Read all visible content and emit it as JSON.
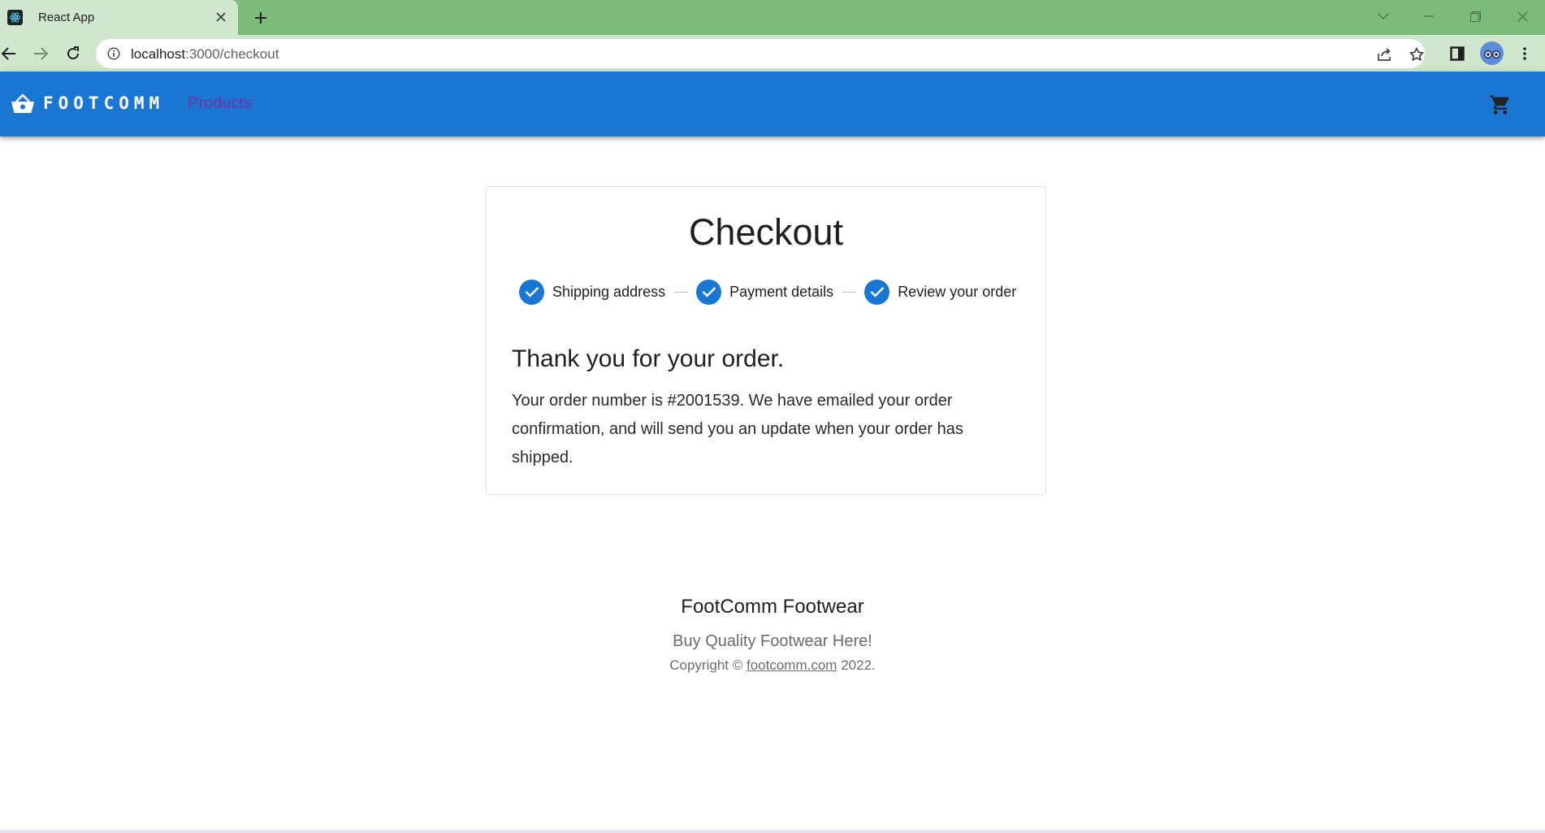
{
  "browser": {
    "tab_title": "React App",
    "url_host": "localhost",
    "url_path": ":3000/checkout"
  },
  "app": {
    "brand": "FOOTCOMM",
    "nav_products": "Products"
  },
  "checkout": {
    "title": "Checkout",
    "steps": [
      {
        "label": "Shipping address",
        "completed": true
      },
      {
        "label": "Payment details",
        "completed": true
      },
      {
        "label": "Review your order",
        "completed": true
      }
    ],
    "thanks_heading": "Thank you for your order.",
    "order_message": "Your order number is #2001539. We have emailed your order confirmation, and will send you an update when your order has shipped."
  },
  "footer": {
    "title": "FootComm Footwear",
    "tagline": "Buy Quality Footwear Here!",
    "copyright_prefix": "Copyright ©",
    "link_text": "footcomm.com",
    "copyright_suffix": "2022."
  },
  "colors": {
    "tab_bar": "#7cbb7a",
    "toolbar": "#cfe8cd",
    "app_bar": "#1976d2",
    "step_icon": "#1976d2",
    "nav_link": "#7b2fa8"
  },
  "icons": {
    "favicon": "react-icon",
    "back": "arrow-left-icon",
    "forward": "arrow-right-icon",
    "reload": "reload-icon",
    "site_info": "info-icon",
    "share": "share-icon",
    "bookmark": "star-icon",
    "side_panel": "side-panel-icon",
    "menu": "kebab-menu-icon",
    "brand": "shopping-basket-icon",
    "cart": "shopping-cart-icon",
    "step": "check-circle-icon"
  }
}
